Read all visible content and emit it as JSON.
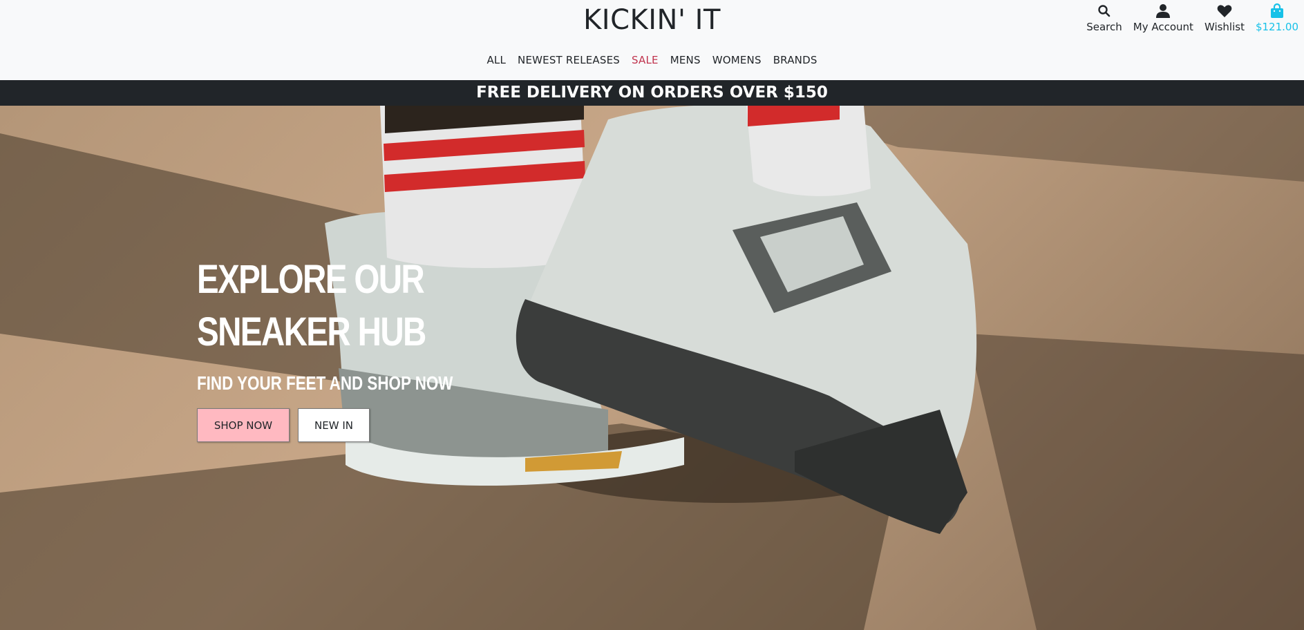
{
  "header": {
    "logo": "KICKIN' IT",
    "icons": [
      {
        "name": "search-icon",
        "label": "Search"
      },
      {
        "name": "user-icon",
        "label": "My Account"
      },
      {
        "name": "heart-icon",
        "label": "Wishlist"
      },
      {
        "name": "shopping-bag-icon",
        "label": "$121.00"
      }
    ]
  },
  "nav": {
    "items": [
      {
        "label": "ALL"
      },
      {
        "label": "NEWEST RELEASES"
      },
      {
        "label": "SALE"
      },
      {
        "label": "MENS"
      },
      {
        "label": "WOMENS"
      },
      {
        "label": "BRANDS"
      }
    ]
  },
  "banner": {
    "text": "FREE DELIVERY ON ORDERS OVER $150"
  },
  "hero": {
    "title_line1": "EXPLORE OUR",
    "title_line2": "SNEAKER HUB",
    "subtitle": "FIND YOUR FEET AND SHOP NOW",
    "shop_button": "SHOP NOW",
    "new_button": "NEW IN"
  },
  "colors": {
    "accent": "#17c1e8",
    "sale": "#c0334d",
    "banner_bg": "#212529",
    "shop_button_bg": "#ffb9c1"
  }
}
